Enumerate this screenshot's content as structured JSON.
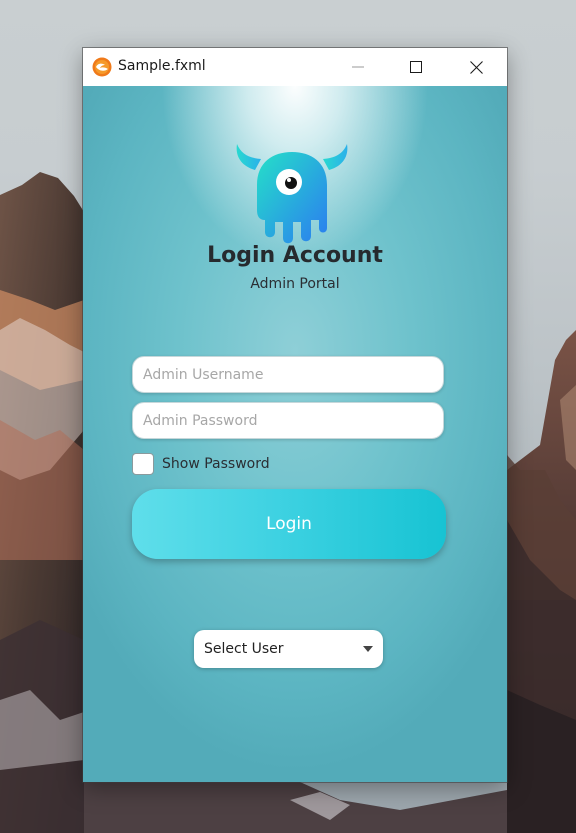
{
  "window": {
    "title": "Sample.fxml",
    "app_icon": "javafx-app-icon",
    "controls": [
      "minimize-icon",
      "maximize-icon",
      "close-icon"
    ]
  },
  "header": {
    "logo": "monster-logo",
    "title": "Login Account",
    "subtitle": "Admin Portal"
  },
  "form": {
    "username_placeholder": "Admin Username",
    "username_value": "",
    "password_placeholder": "Admin Password",
    "password_value": "",
    "show_password_label": "Show Password",
    "show_password_checked": false,
    "login_label": "Login"
  },
  "user_select": {
    "selected": "Select User",
    "icon": "caret-down-icon"
  },
  "colors": {
    "accent": "#3fd2e2",
    "background": "#6ec2cc",
    "logo_gradient_start": "#25e0c8",
    "logo_gradient_end": "#2b7cf0"
  }
}
